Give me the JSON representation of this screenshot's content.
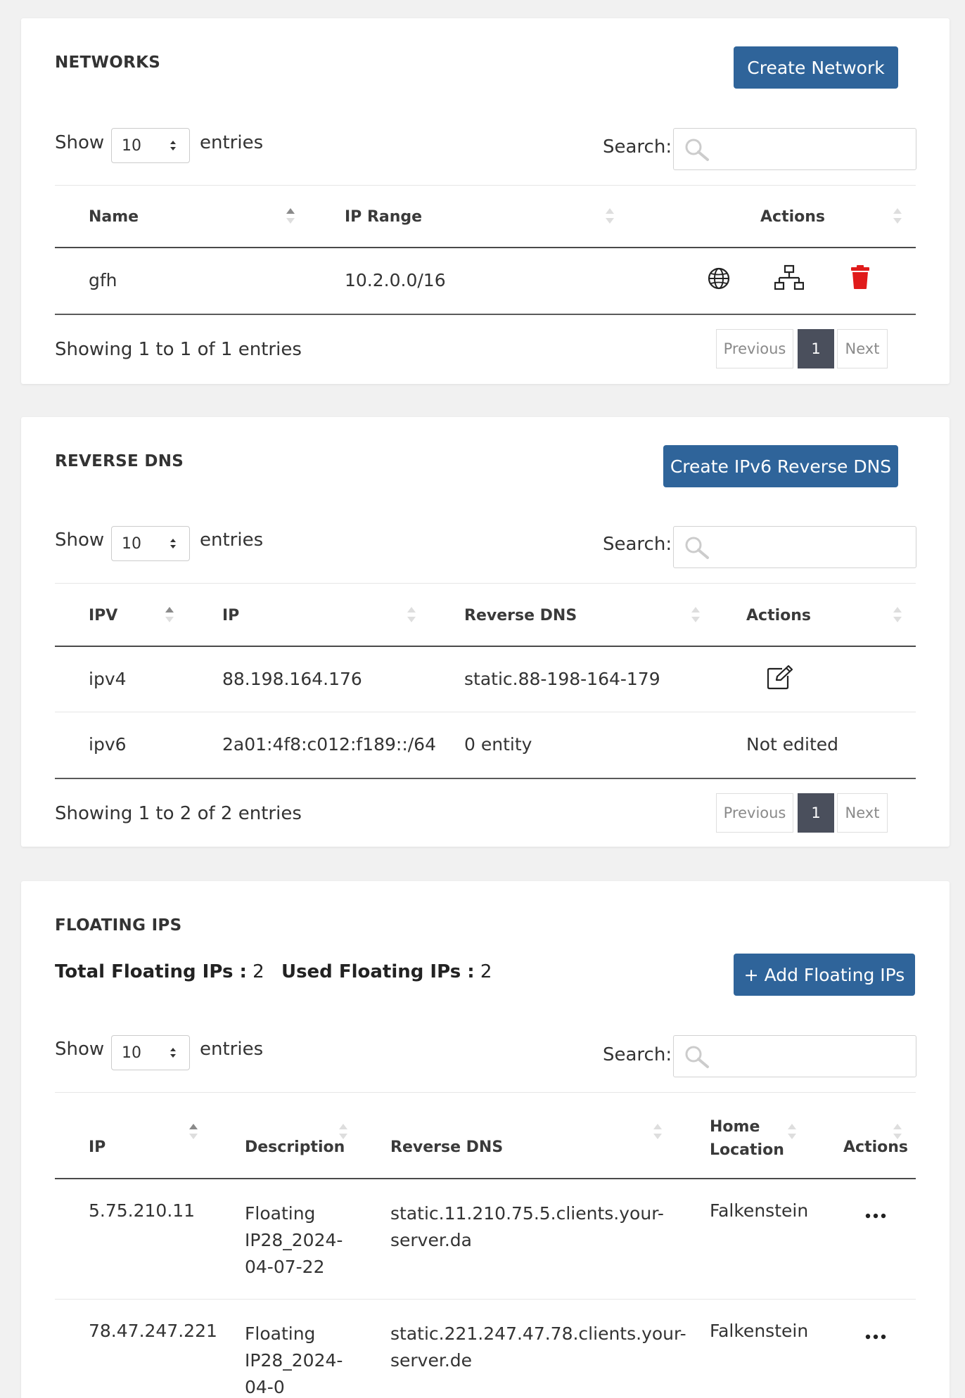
{
  "networks": {
    "title": "NETWORKS",
    "create_label": "Create Network",
    "show_label": "Show",
    "entries_value": "10",
    "entries_label": "entries",
    "search_label": "Search:",
    "columns": [
      "Name",
      "IP Range",
      "Actions"
    ],
    "rows": [
      {
        "name": "gfh",
        "ip_range": "10.2.0.0/16"
      }
    ],
    "info": "Showing 1 to 1 of 1 entries",
    "prev": "Previous",
    "page": "1",
    "next": "Next"
  },
  "rdns": {
    "title": "REVERSE DNS",
    "create_label": "Create IPv6 Reverse DNS",
    "show_label": "Show",
    "entries_value": "10",
    "entries_label": "entries",
    "search_label": "Search:",
    "columns": [
      "IPV",
      "IP",
      "Reverse DNS",
      "Actions"
    ],
    "rows": [
      {
        "ipv": "ipv4",
        "ip": "88.198.164.176",
        "rdns": "static.88-198-164-179",
        "action": ""
      },
      {
        "ipv": "ipv6",
        "ip": "2a01:4f8:c012:f189::/64",
        "rdns": "0 entity",
        "action": "Not edited"
      }
    ],
    "info": "Showing 1 to 2 of 2 entries",
    "prev": "Previous",
    "page": "1",
    "next": "Next"
  },
  "floating": {
    "title": "FLOATING IPS",
    "total_label": "Total Floating IPs :",
    "total_value": "2",
    "used_label": "Used Floating IPs :",
    "used_value": "2",
    "add_label": "+ Add Floating IPs",
    "show_label": "Show",
    "entries_value": "10",
    "entries_label": "entries",
    "search_label": "Search:",
    "columns": {
      "ip": "IP",
      "description": "Description",
      "rdns": "Reverse DNS",
      "home_1": "Home",
      "home_2": "Location",
      "actions": "Actions"
    },
    "rows": [
      {
        "ip": "5.75.210.11",
        "desc": [
          "Floating",
          "IP28_2024-",
          "04-07-22"
        ],
        "rdns": [
          "static.11.210.75.5.clients.your-",
          "server.da"
        ],
        "location": "Falkenstein"
      },
      {
        "ip": "78.47.247.221",
        "desc": [
          "Floating",
          "IP28_2024-",
          "04-0"
        ],
        "rdns": [
          "static.221.247.47.78.clients.your-",
          "server.de"
        ],
        "location": "Falkenstein"
      }
    ]
  },
  "icons": [
    "globe-icon",
    "network-icon",
    "trash-icon",
    "edit-icon",
    "more-icon",
    "search-icon",
    "sort-icon"
  ],
  "colors": {
    "primary": "#2f649a",
    "danger": "#e01b1b",
    "active_page": "#4a4f5c"
  }
}
